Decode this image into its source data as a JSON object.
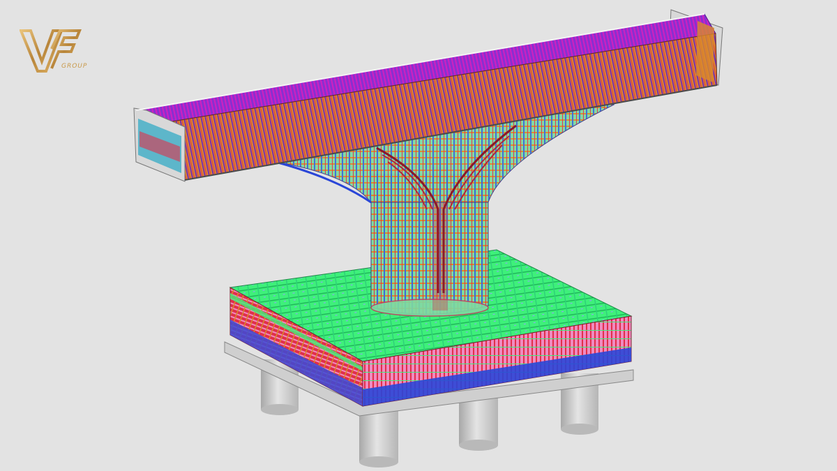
{
  "brand": {
    "logo_letters": "VF",
    "logo_word": "GROUP",
    "logo_color": "#c99a4b"
  },
  "scene": {
    "background": "#e3e3e3",
    "colors": {
      "purple": "#6a1fa0",
      "magenta": "#d020c0",
      "orange": "#d98a2a",
      "green": "#3ef07a",
      "red": "#e0304a",
      "blue": "#2a46d8",
      "pink": "#f08ac0",
      "concrete": "#c9c9c9",
      "pile": "#d2d2d2"
    }
  }
}
